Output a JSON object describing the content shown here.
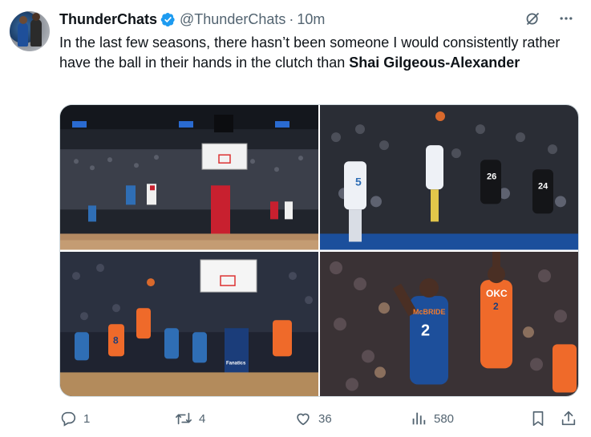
{
  "tweet": {
    "author_name": "ThunderChats",
    "handle": "@ThunderChats",
    "separator": "·",
    "time": "10m",
    "text_prefix": "In the last few seasons, there hasn’t been someone I would consistently rather have the ball in their hands in the clutch than ",
    "text_bold": "Shai Gilgeous-Alexander"
  },
  "icons": {
    "verified": "verified-badge-icon",
    "grok": "grok-icon",
    "more": "more-options-icon",
    "reply": "reply-icon",
    "retweet": "retweet-icon",
    "like": "like-icon",
    "views": "views-icon",
    "bookmark": "bookmark-icon",
    "share": "share-icon"
  },
  "media": {
    "jersey_numbers": [
      "5",
      "2",
      "26",
      "24",
      "8",
      "2"
    ],
    "arena_signs": [
      "Fanatics",
      "McBRIDE",
      "OKC"
    ]
  },
  "stats": {
    "replies": "1",
    "retweets": "4",
    "likes": "36",
    "views": "580"
  },
  "colors": {
    "text": "#0f1419",
    "secondary": "#536471",
    "verified": "#1d9bf0",
    "thunder_blue": "#2f6eb5",
    "thunder_orange": "#ef6a2a",
    "knicks_blue": "#1d4f9b"
  }
}
